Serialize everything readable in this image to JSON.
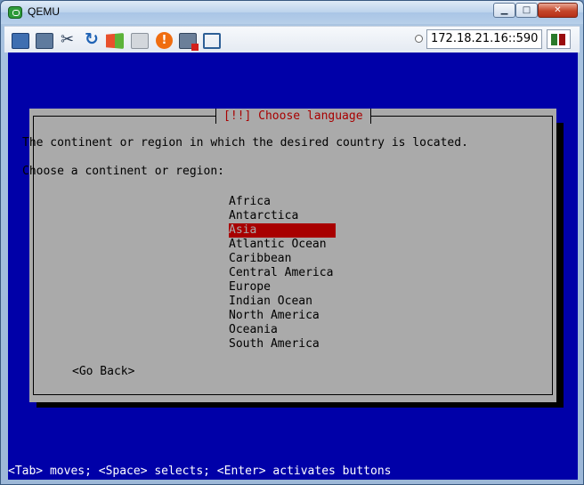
{
  "window": {
    "title": "QEMU",
    "icons": {
      "app": "qemu-icon",
      "minimize": "minimize-icon",
      "maximize": "maximize-icon",
      "close": "close-icon"
    },
    "minimize_glyph": "▁",
    "maximize_glyph": "□",
    "close_glyph": "✕"
  },
  "toolbar": {
    "buttons": [
      {
        "name": "monitor-icon"
      },
      {
        "name": "windows-icon"
      },
      {
        "name": "settings-tools-icon"
      },
      {
        "name": "refresh-icon"
      },
      {
        "name": "windows-logo-icon"
      },
      {
        "name": "keyboard-icon"
      },
      {
        "name": "alert-icon",
        "glyph": "!"
      },
      {
        "name": "disconnect-icon"
      },
      {
        "name": "fullscreen-icon"
      }
    ],
    "address": "172.18.21.16::590",
    "signal_icon": "signal-icon"
  },
  "dialog": {
    "title": "[!!] Choose language",
    "description": "The continent or region in which the desired country is located.",
    "prompt": "Choose a continent or region:",
    "options": [
      "Africa",
      "Antarctica",
      "Asia",
      "Atlantic Ocean",
      "Caribbean",
      "Central America",
      "Europe",
      "Indian Ocean",
      "North America",
      "Oceania",
      "South America"
    ],
    "selected_index": 2,
    "go_back": "<Go Back>"
  },
  "status_bar": "<Tab> moves; <Space> selects; <Enter> activates buttons",
  "colors": {
    "console_bg": "#0000a8",
    "dialog_bg": "#aaaaaa",
    "accent_red": "#a80000",
    "status_text": "#ffffff"
  }
}
